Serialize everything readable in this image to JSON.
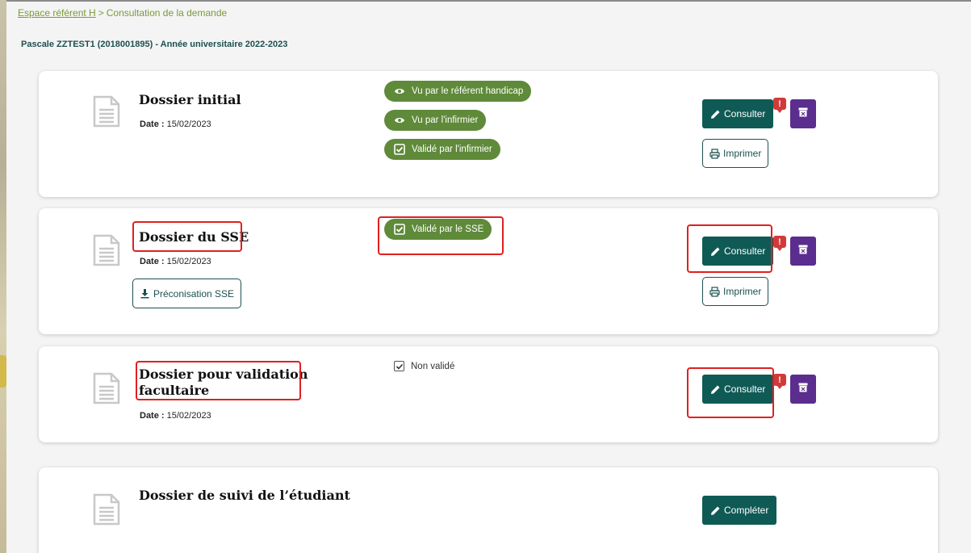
{
  "breadcrumb": {
    "link": "Espace référent H",
    "separator": ">",
    "current": "Consultation de la demande"
  },
  "student": {
    "title": "Pascale ZZTEST1 (2018001895) - Année universitaire 2022-2023"
  },
  "labels": {
    "date_label": "Date :",
    "consult": "Consulter",
    "print": "Imprimer",
    "alert": "!",
    "complete": "Compléter"
  },
  "cards": [
    {
      "title": "Dossier initial",
      "date": "15/02/2023",
      "badges": [
        "Vu par le référent handicap",
        "Vu par l'infirmier",
        "Validé par l'infirmier"
      ]
    },
    {
      "title": "Dossier du SSE",
      "date": "15/02/2023",
      "extra_button": "Préconisation SSE",
      "badges": [
        "Validé par le SSE"
      ]
    },
    {
      "title_line1": "Dossier pour validation",
      "title_line2": "facultaire",
      "date": "15/02/2023",
      "status": "Non validé"
    },
    {
      "title": "Dossier de suivi de l’étudiant"
    }
  ],
  "colors": {
    "accent_teal": "#0f5a55",
    "badge_green": "#5f8a3a",
    "archive_purple": "#5b2d8e",
    "alert_red": "#d23a3a",
    "breadcrumb_green": "#7a9a3a",
    "highlight_red": "#e02020"
  },
  "icons": {
    "document": "document-icon",
    "eye": "eye-icon",
    "checkbox": "checkbox-checked-icon",
    "pencil": "pencil-icon",
    "printer": "printer-icon",
    "archive": "archive-icon",
    "download": "download-icon"
  }
}
